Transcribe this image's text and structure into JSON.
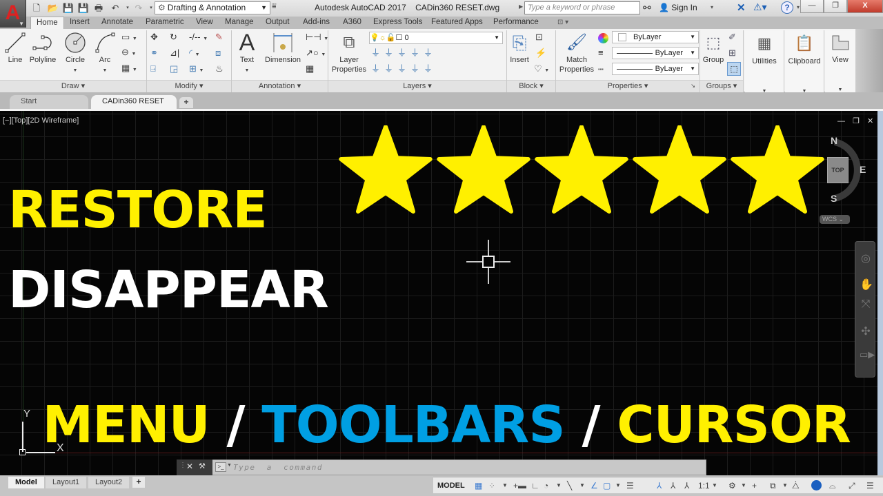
{
  "titlebar": {
    "app_logo": "A",
    "quick_access": [
      "new-icon",
      "open-icon",
      "save-icon",
      "save-as-icon",
      "plot-icon",
      "undo-icon",
      "redo-icon"
    ],
    "workspace": "Drafting & Annotation",
    "app_title": "Autodesk AutoCAD 2017    CADin360 RESET.dwg",
    "search_placeholder": "Type a keyword or phrase",
    "sign_in": "Sign In",
    "help": "?",
    "window": {
      "minimize": "—",
      "restore": "❐",
      "close": "X"
    }
  },
  "ribbon_tabs": [
    "Home",
    "Insert",
    "Annotate",
    "Parametric",
    "View",
    "Manage",
    "Output",
    "Add-ins",
    "A360",
    "Express Tools",
    "Featured Apps",
    "Performance"
  ],
  "ribbon": {
    "draw": {
      "title": "Draw",
      "tools": [
        "Line",
        "Polyline",
        "Circle",
        "Arc"
      ]
    },
    "modify": {
      "title": "Modify"
    },
    "annotation": {
      "title": "Annotation",
      "tools": [
        "Text",
        "Dimension"
      ]
    },
    "layers": {
      "title": "Layers",
      "tool": "Layer Properties",
      "layer_value": "0"
    },
    "block": {
      "title": "Block",
      "tool": "Insert"
    },
    "properties": {
      "title": "Properties",
      "tool": "Match Properties",
      "color": "ByLayer",
      "lineweight": "ByLayer",
      "linetype": "ByLayer"
    },
    "groups": {
      "title": "Groups",
      "tool": "Group"
    },
    "utilities": "Utilities",
    "clipboard": "Clipboard",
    "view": "View"
  },
  "doc_tabs": {
    "start": "Start",
    "active": "CADin360 RESET",
    "close": "×",
    "add": "+"
  },
  "viewport": {
    "label": "[−][Top][2D Wireframe]",
    "controls": "— ❐ ✕",
    "overlay": {
      "line1": "RESTORE",
      "line2": "DISAPPEAR",
      "line3": [
        {
          "text": "MENU",
          "color": "#fff000"
        },
        {
          "text": " / ",
          "color": "#ffffff"
        },
        {
          "text": "TOOLBARS",
          "color": "#009fe3"
        },
        {
          "text": " / ",
          "color": "#ffffff"
        },
        {
          "text": "CURSOR",
          "color": "#fff000"
        }
      ],
      "rating": {
        "filled": 5,
        "total": 5,
        "color": "#fff000"
      }
    },
    "viewcube": {
      "top": "TOP",
      "n": "N",
      "e": "E",
      "s": "S",
      "wcs": "WCS ⌄"
    },
    "ucs": {
      "x": "X",
      "y": "Y"
    }
  },
  "command_line": {
    "placeholder": "Type  a  command",
    "close": "✕",
    "settings": "🔧",
    "prompt": ">_"
  },
  "layout_tabs": [
    "Model",
    "Layout1",
    "Layout2"
  ],
  "layout_add": "+",
  "status_bar": {
    "model": "MODEL",
    "scale": "1:1"
  }
}
